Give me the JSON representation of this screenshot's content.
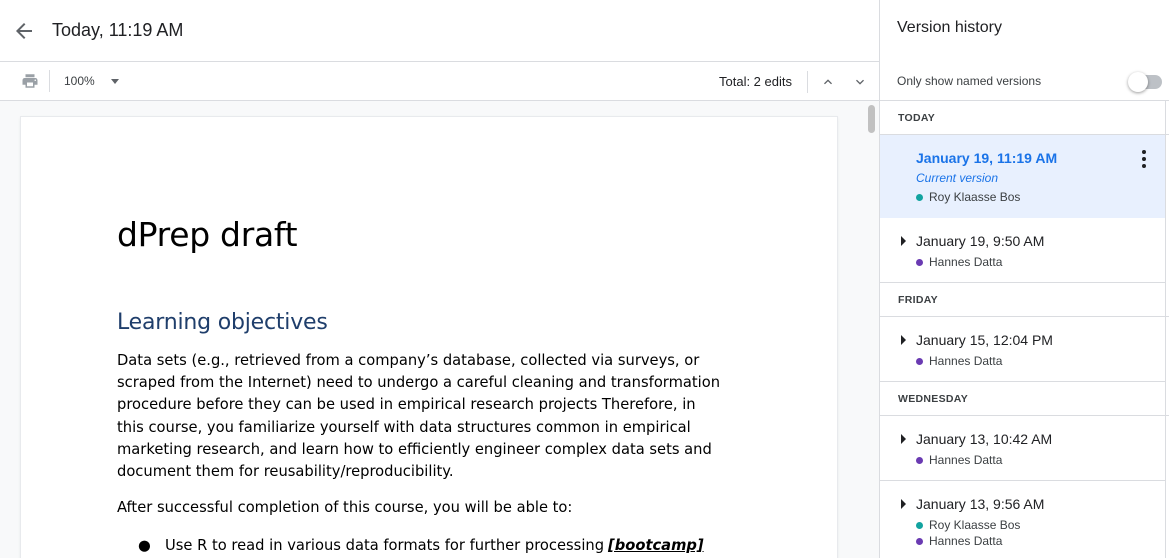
{
  "header": {
    "title": "Today, 11:19 AM"
  },
  "toolbar": {
    "zoom": "100%",
    "total_edits": "Total: 2 edits"
  },
  "document": {
    "title": "dPrep draft",
    "heading": "Learning objectives",
    "paragraph": "Data sets (e.g., retrieved from a company’s database, collected via surveys, or scraped from the Internet) need to undergo a careful cleaning and transformation procedure before they can be used in empirical research projects Therefore, in this course, you familiarize yourself with data structures common in empirical marketing research, and learn how to efficiently engineer complex data sets and document them for reusability/reproducibility.",
    "lead_in": "After successful completion of this course, you will be able to:",
    "bullet": "●",
    "list_item": "Use R to read in various data formats for further processing",
    "list_item_tag": "[bootcamp]"
  },
  "panel": {
    "title": "Version history",
    "named_toggle_label": "Only show named versions",
    "named_toggle_on": false,
    "sections": [
      {
        "label": "TODAY",
        "versions": [
          {
            "date": "January 19, 11:19 AM",
            "current_label": "Current version",
            "users": [
              {
                "name": "Roy Klaasse Bos",
                "color": "#12a3a0"
              }
            ]
          },
          {
            "date": "January 19, 9:50 AM",
            "users": [
              {
                "name": "Hannes Datta",
                "color": "#6a3ab2"
              }
            ]
          }
        ]
      },
      {
        "label": "FRIDAY",
        "versions": [
          {
            "date": "January 15, 12:04 PM",
            "users": [
              {
                "name": "Hannes Datta",
                "color": "#6a3ab2"
              }
            ]
          }
        ]
      },
      {
        "label": "WEDNESDAY",
        "versions": [
          {
            "date": "January 13, 10:42 AM",
            "users": [
              {
                "name": "Hannes Datta",
                "color": "#6a3ab2"
              }
            ]
          },
          {
            "date": "January 13, 9:56 AM",
            "users": [
              {
                "name": "Roy Klaasse Bos",
                "color": "#12a3a0"
              },
              {
                "name": "Hannes Datta",
                "color": "#6a3ab2"
              }
            ]
          }
        ]
      }
    ]
  },
  "colors": {
    "accent": "#1a73e8",
    "selected_bg": "#e8f0fe",
    "heading": "#1f3e6b",
    "border": "#dadce0"
  },
  "icons": [
    "back-arrow-icon",
    "print-icon",
    "chevron-down-icon",
    "chevron-up-icon",
    "caret-right-icon",
    "more-vert-icon"
  ]
}
